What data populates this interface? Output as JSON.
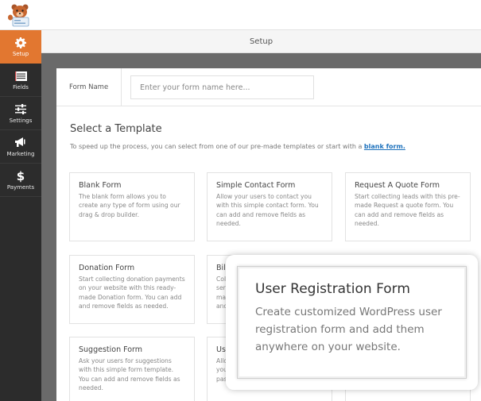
{
  "app": {
    "logo": "wpforms-bear-logo"
  },
  "sidebar": {
    "items": [
      {
        "label": "Setup",
        "icon": "gear-icon",
        "active": true
      },
      {
        "label": "Fields",
        "icon": "fields-list-icon",
        "active": false
      },
      {
        "label": "Settings",
        "icon": "sliders-icon",
        "active": false
      },
      {
        "label": "Marketing",
        "icon": "megaphone-icon",
        "active": false
      },
      {
        "label": "Payments",
        "icon": "dollar-icon",
        "active": false
      }
    ],
    "accent_color": "#e27730"
  },
  "header": {
    "title": "Setup"
  },
  "form_name": {
    "label": "Form Name",
    "value": "",
    "placeholder": "Enter your form name here..."
  },
  "templates": {
    "title": "Select a Template",
    "description": "To speed up the process, you can select from one of our pre-made templates or start with a",
    "blank_link": "blank form.",
    "cards": [
      {
        "title": "Blank Form",
        "description": "The blank form allows you to create any type of form using our drag & drop builder."
      },
      {
        "title": "Simple Contact Form",
        "description": "Allow your users to contact you with this simple contact form. You can add and remove fields as needed."
      },
      {
        "title": "Request A Quote Form",
        "description": "Start collecting leads with this pre-made Request a quote form. You can add and remove fields as needed."
      },
      {
        "title": "Donation Form",
        "description": "Start collecting donation payments on your website with this ready-made Donation form. You can add and remove fields as needed."
      },
      {
        "title": "Billing / Order Form",
        "description": "Collect payments for product and service orders with this ready-made form template. You can add and remove fields as needed."
      },
      {
        "title": "",
        "description": ""
      },
      {
        "title": "Suggestion Form",
        "description": "Ask your users for suggestions with this simple form template. You can add and remove fields as needed."
      },
      {
        "title": "User Registration Form",
        "description": "Allow your users to register on your site. Enter username and password."
      },
      {
        "title": "",
        "description": ""
      }
    ]
  },
  "tooltip": {
    "title": "User Registration Form",
    "description": "Create customized WordPress user registration form and add them anywhere on your website."
  }
}
